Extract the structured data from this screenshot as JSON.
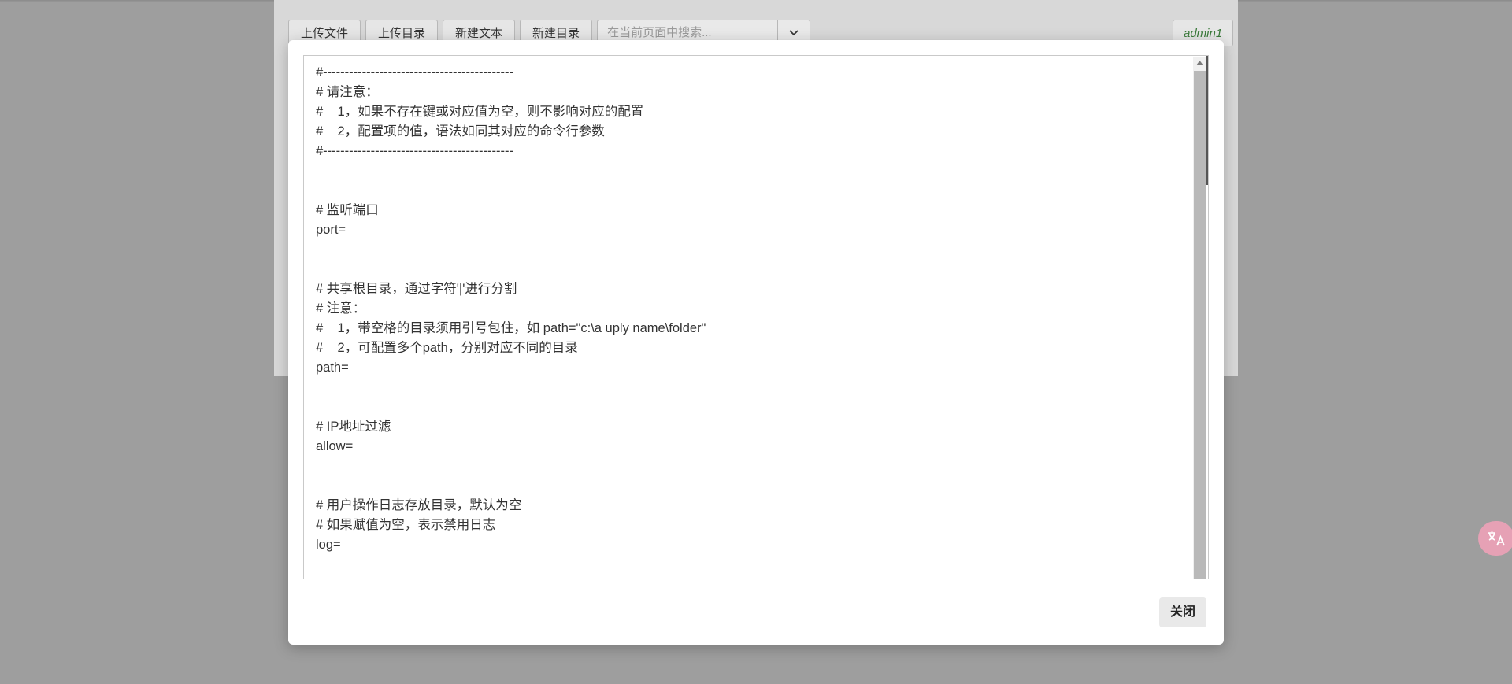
{
  "toolbar": {
    "upload_file": "上传文件",
    "upload_dir": "上传目录",
    "new_text": "新建文本",
    "new_dir": "新建目录",
    "search_placeholder": "在当前页面中搜索..."
  },
  "user": {
    "name": "admin1"
  },
  "editor": {
    "content": "#--------------------------------------------\n# 请注意：\n#    1，如果不存在键或对应值为空，则不影响对应的配置\n#    2，配置项的值，语法如同其对应的命令行参数\n#--------------------------------------------\n\n\n# 监听端口\nport=\n\n\n# 共享根目录，通过字符'|'进行分割\n# 注意：\n#    1，带空格的目录须用引号包住，如 path=\"c:\\a uply name\\folder\"\n#    2，可配置多个path，分别对应不同的目录\npath=\n\n\n# IP地址过滤\nallow=\n\n\n# 用户操作日志存放目录，默认为空\n# 如果赋值为空，表示禁用日志\nlog="
  },
  "modal": {
    "close_label": "关闭"
  },
  "icons": {
    "dropdown": "chevron-down-icon",
    "scroll_up": "triangle-up-icon",
    "translate": "translate-icon"
  },
  "colors": {
    "overlay": "#9e9e9e",
    "user_text": "#3a7a3a",
    "translate_fab": "#e6a1b5"
  }
}
